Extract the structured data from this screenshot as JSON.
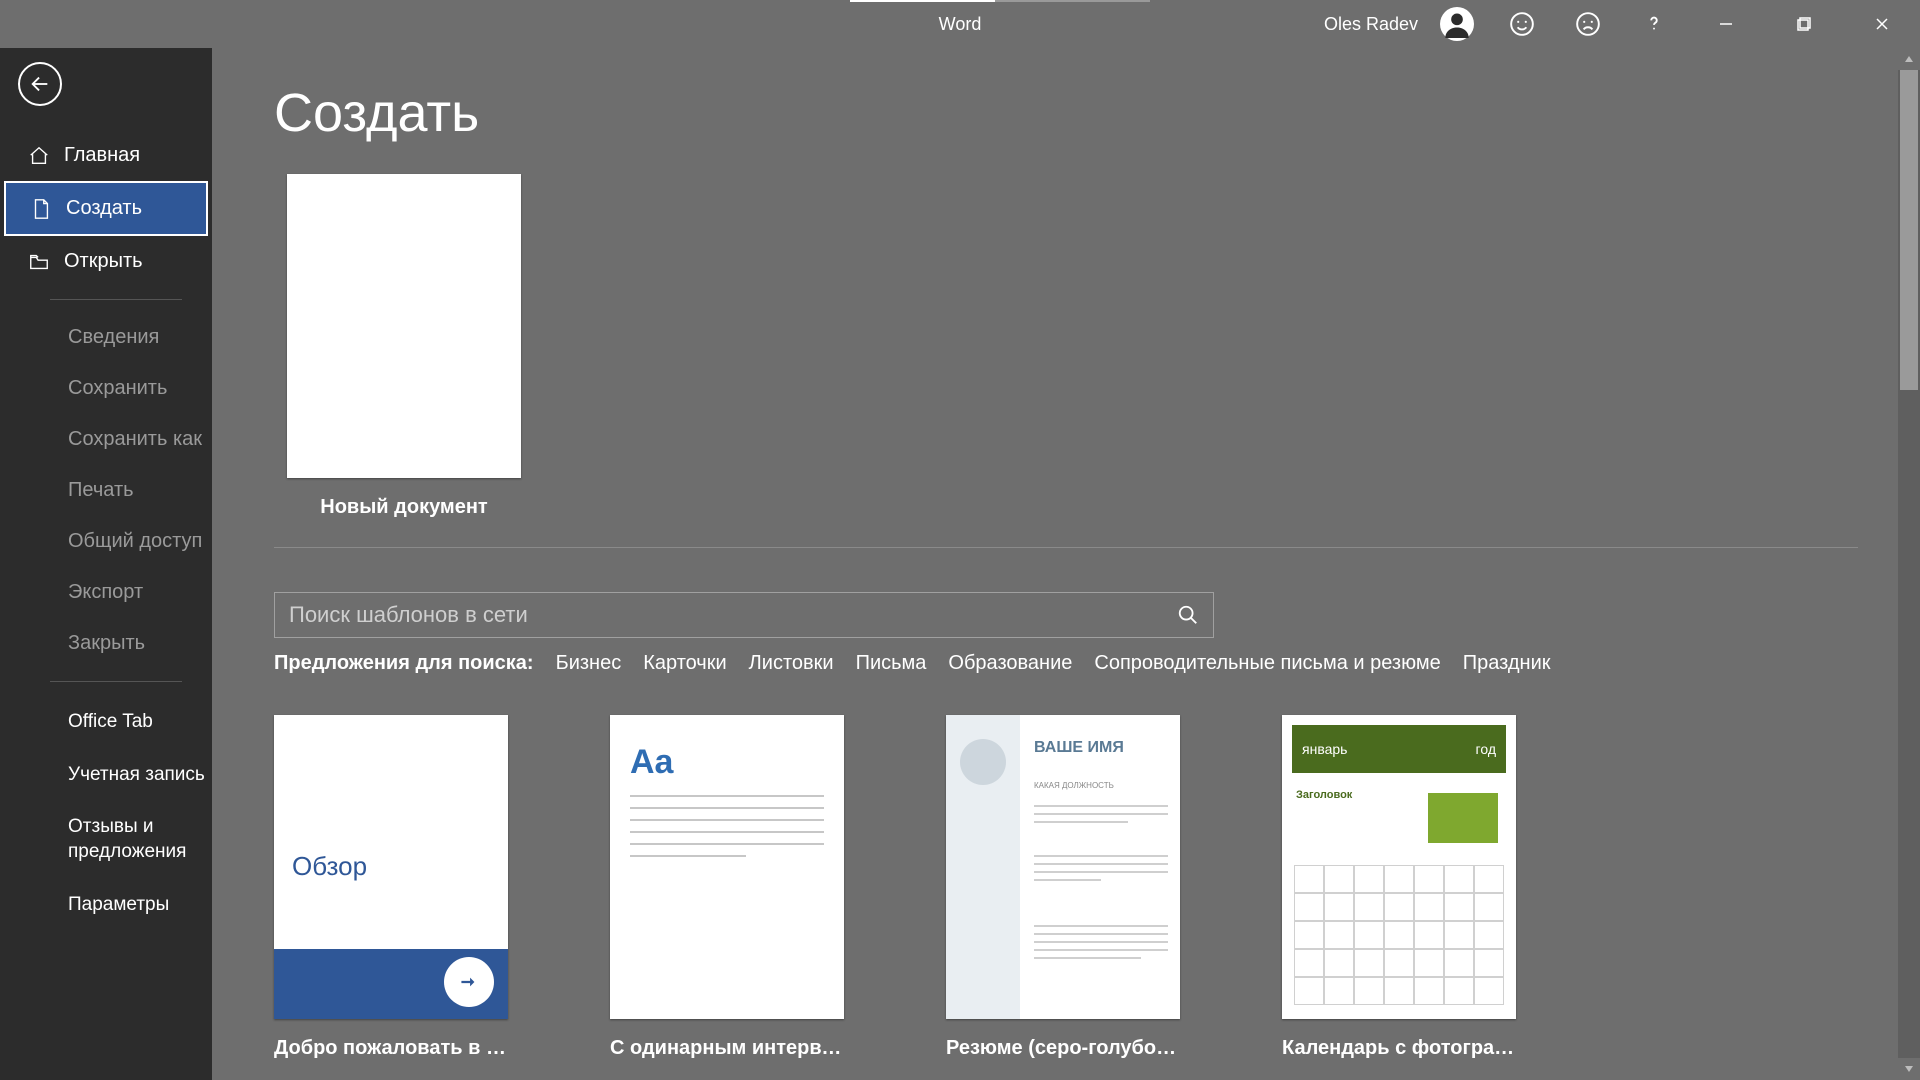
{
  "app": {
    "title": "Word",
    "username": "Oles Radev"
  },
  "sidebar": {
    "top": [
      {
        "label": "Главная",
        "icon": "home"
      },
      {
        "label": "Создать",
        "icon": "doc",
        "selected": true
      },
      {
        "label": "Открыть",
        "icon": "folder"
      }
    ],
    "mid": [
      {
        "label": "Сведения"
      },
      {
        "label": "Сохранить"
      },
      {
        "label": "Сохранить как"
      },
      {
        "label": "Печать"
      },
      {
        "label": "Общий доступ"
      },
      {
        "label": "Экспорт"
      },
      {
        "label": "Закрыть"
      }
    ],
    "bottom": [
      {
        "label": "Office Tab"
      },
      {
        "label": "Учетная запись"
      },
      {
        "label": "Отзывы и предложения"
      },
      {
        "label": "Параметры"
      }
    ]
  },
  "page": {
    "title": "Создать",
    "blank_label": "Новый документ",
    "search_placeholder": "Поиск шаблонов в сети",
    "suggest_label": "Предложения для поиска:",
    "suggestions": [
      "Бизнес",
      "Карточки",
      "Листовки",
      "Письма",
      "Образование",
      "Сопроводительные письма и резюме",
      "Праздник"
    ],
    "templates": [
      {
        "label": "Добро пожаловать в W…",
        "kind": "welcome",
        "preview_text": "Обзор"
      },
      {
        "label": "С одинарным интервал…",
        "kind": "single",
        "preview_text": "Aa"
      },
      {
        "label": "Резюме (серо-голубое…",
        "kind": "resume",
        "preview_name": "ВАШЕ ИМЯ",
        "preview_sub": "КАКАЯ ДОЛЖНОСТЬ"
      },
      {
        "label": "Календарь с фотографи…",
        "kind": "calendar",
        "preview_month": "январь",
        "preview_year": "год",
        "preview_heading": "Заголовок"
      }
    ]
  }
}
